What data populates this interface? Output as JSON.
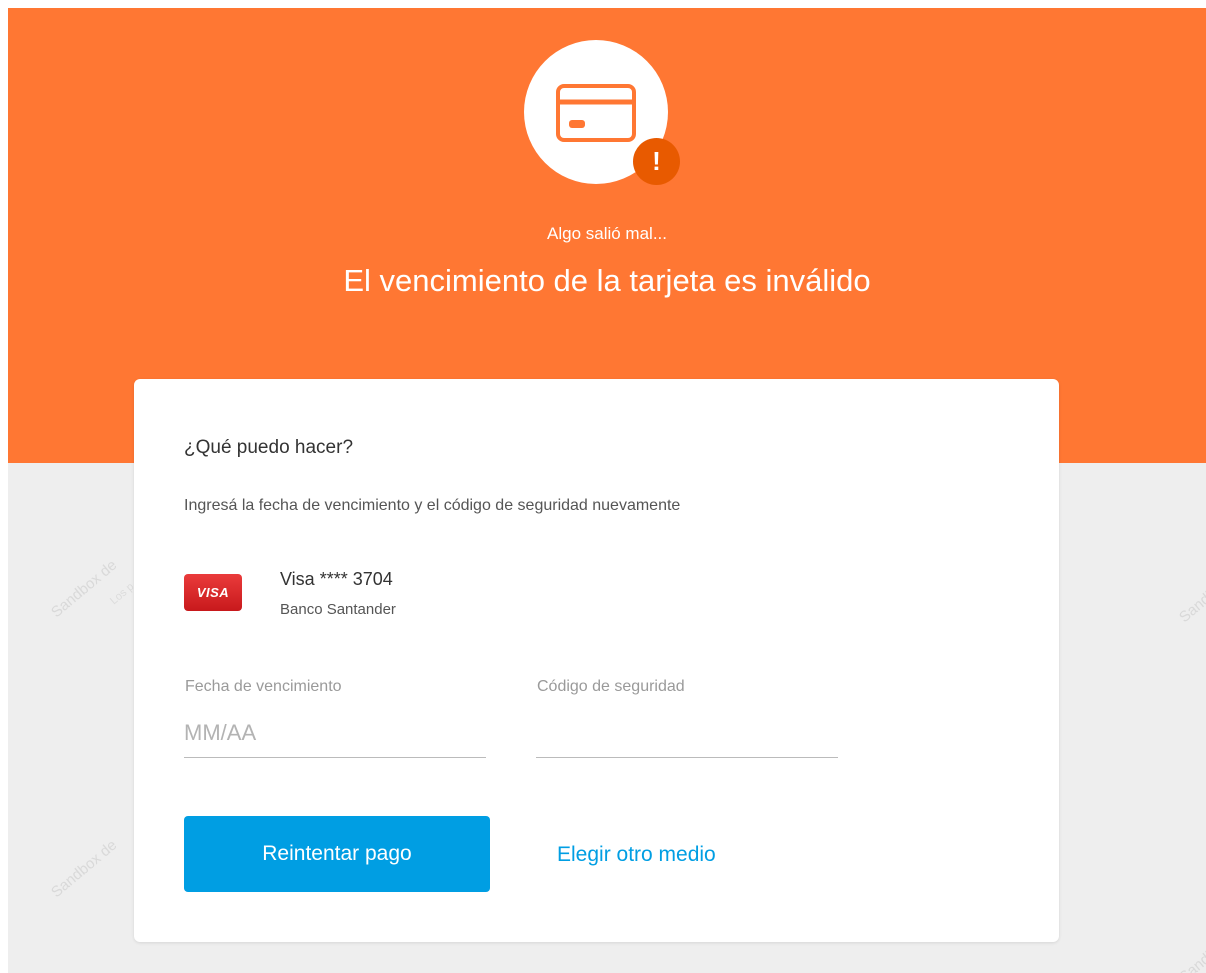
{
  "header": {
    "subtitle": "Algo salió mal...",
    "title": "El vencimiento de la tarjeta es inválido",
    "alert_icon_glyph": "!"
  },
  "card": {
    "heading": "¿Qué puedo hacer?",
    "instruction": "Ingresá la fecha de vencimiento y el código de seguridad nuevamente",
    "payment_method": {
      "logo_text": "VISA",
      "number": "Visa **** 3704",
      "bank": "Banco Santander"
    },
    "fields": {
      "expiry_label": "Fecha de vencimiento",
      "expiry_placeholder": "MM/AA",
      "expiry_value": "",
      "cvv_label": "Código de seguridad",
      "cvv_placeholder": "",
      "cvv_value": ""
    },
    "actions": {
      "retry_label": "Reintentar pago",
      "other_method_label": "Elegir otro medio"
    }
  },
  "watermark": {
    "main_text": "Sandbox de",
    "sub_text": "Los p"
  },
  "colors": {
    "header_orange": "#ff7733",
    "alert_badge": "#e85a00",
    "primary_blue": "#009ee3",
    "background_gray": "#eeeeee"
  },
  "icons": [
    "credit-card-icon",
    "alert-icon",
    "visa-logo"
  ]
}
